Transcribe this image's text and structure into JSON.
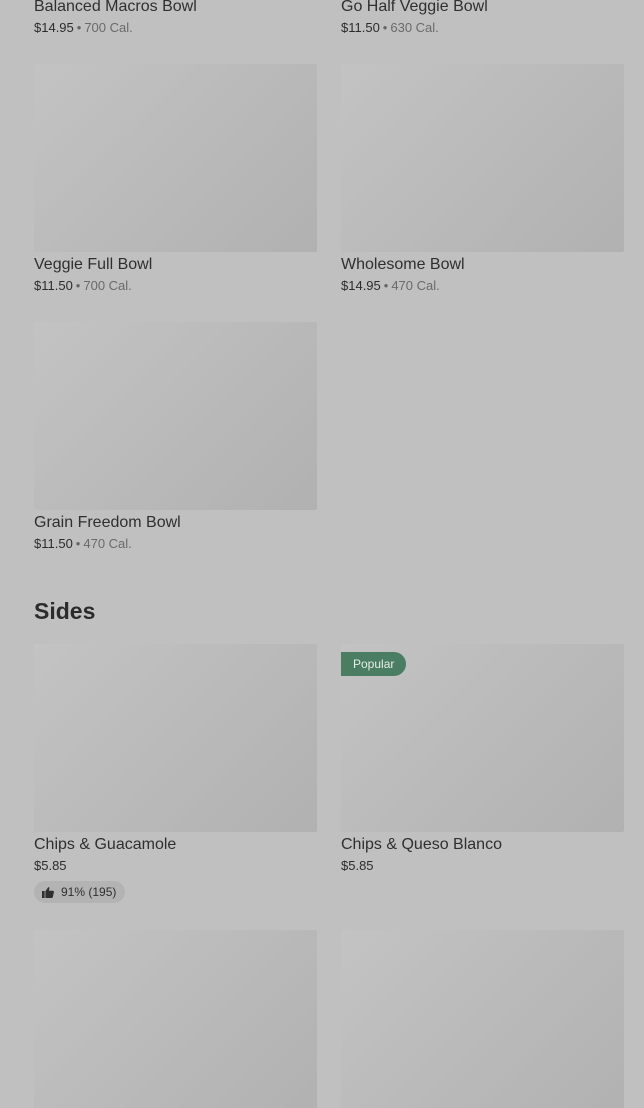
{
  "items_top": [
    {
      "name": "Balanced Macros Bowl",
      "price": "$14.95",
      "sep": "•",
      "calories": "700 Cal."
    },
    {
      "name": "Go Half Veggie Bowl",
      "price": "$11.50",
      "sep": "•",
      "calories": "630 Cal."
    },
    {
      "name": "Veggie Full Bowl",
      "price": "$11.50",
      "sep": "•",
      "calories": "700 Cal."
    },
    {
      "name": "Wholesome Bowl",
      "price": "$14.95",
      "sep": "•",
      "calories": "470 Cal."
    },
    {
      "name": "Grain Freedom Bowl",
      "price": "$11.50",
      "sep": "•",
      "calories": "470 Cal."
    }
  ],
  "sides": {
    "title": "Sides",
    "items": [
      {
        "name": "Chips & Guacamole",
        "price": "$5.85",
        "rating": "91% (195)"
      },
      {
        "name": "Chips & Queso Blanco",
        "price": "$5.85",
        "badge": "Popular"
      }
    ]
  },
  "icons": {
    "rating": "thumbs-up-icon"
  },
  "colors": {
    "background": "#c0c0c0",
    "popular_badge": "#4a7d61",
    "rating_pill": "#b3b3b3"
  }
}
